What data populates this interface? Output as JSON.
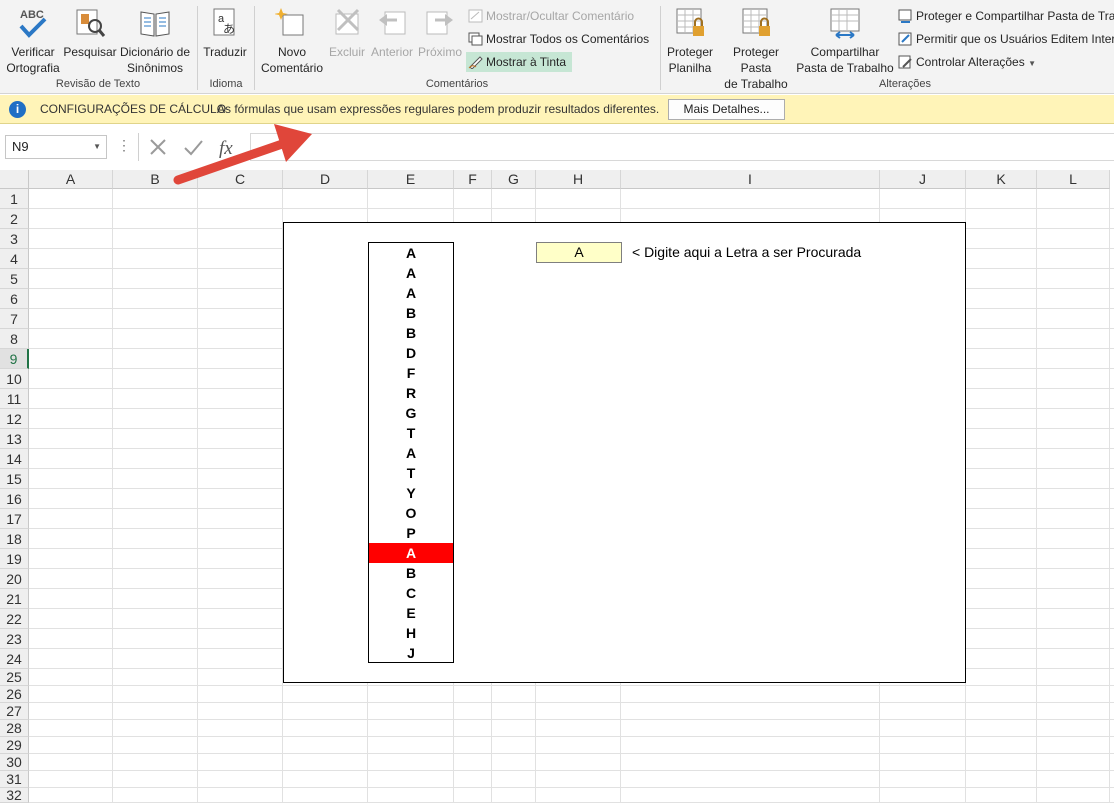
{
  "ribbon": {
    "buttons": {
      "spelling": "Verificar\nOrtografia",
      "research": "Pesquisar",
      "thesaurus": "Dicionário de\nSinônimos",
      "translate": "Traduzir",
      "new_comment": "Novo\nComentário",
      "delete": "Excluir",
      "previous": "Anterior",
      "next": "Próximo",
      "show_hide_comment": "Mostrar/Ocultar Comentário",
      "show_all_comments": "Mostrar Todos os Comentários",
      "show_ink": "Mostrar à Tinta",
      "protect_sheet": "Proteger\nPlanilha",
      "protect_workbook": "Proteger Pasta\nde Trabalho",
      "share_workbook": "Compartilhar\nPasta de Trabalho",
      "protect_share": "Proteger e Compartilhar Pasta de Trab",
      "allow_edit": "Permitir que os Usuários Editem Interv",
      "track_changes": "Controlar Alterações"
    },
    "spelling_glyph": "ABC",
    "groups": {
      "proofing": "Revisão de Texto",
      "language": "Idioma",
      "comments": "Comentários",
      "changes": "Alterações"
    },
    "colors": {
      "ribbon_bg": "#f3f3f3",
      "ink_active": "#c6e6d4",
      "accent_blue": "#2b78c5"
    }
  },
  "infobar": {
    "icon": "info-icon",
    "title": "CONFIGURAÇÕES DE CÁLCULO",
    "message": "As fórmulas que usam expressões regulares podem produzir resultados diferentes.",
    "button": "Mais Detalhes..."
  },
  "formulabar": {
    "namebox": "N9",
    "formula": ""
  },
  "grid": {
    "columns": [
      "A",
      "B",
      "C",
      "D",
      "E",
      "F",
      "G",
      "H",
      "I",
      "J",
      "K",
      "L"
    ],
    "rows": [
      "1",
      "2",
      "3",
      "4",
      "5",
      "6",
      "7",
      "8",
      "9",
      "10",
      "11",
      "12",
      "13",
      "14",
      "15",
      "16",
      "17",
      "18",
      "19",
      "20",
      "21",
      "22",
      "23",
      "24",
      "25",
      "26",
      "27",
      "28",
      "29",
      "30",
      "31",
      "32"
    ],
    "selected_row": "9",
    "letters": [
      "A",
      "A",
      "A",
      "B",
      "B",
      "D",
      "F",
      "R",
      "G",
      "T",
      "A",
      "T",
      "Y",
      "O",
      "P",
      "A",
      "B",
      "C",
      "E",
      "H",
      "J"
    ],
    "highlighted_index": 15,
    "highlight_color": "#ff0000",
    "search_value": "A",
    "search_hint": "< Digite aqui a Letra a ser Procurada"
  }
}
